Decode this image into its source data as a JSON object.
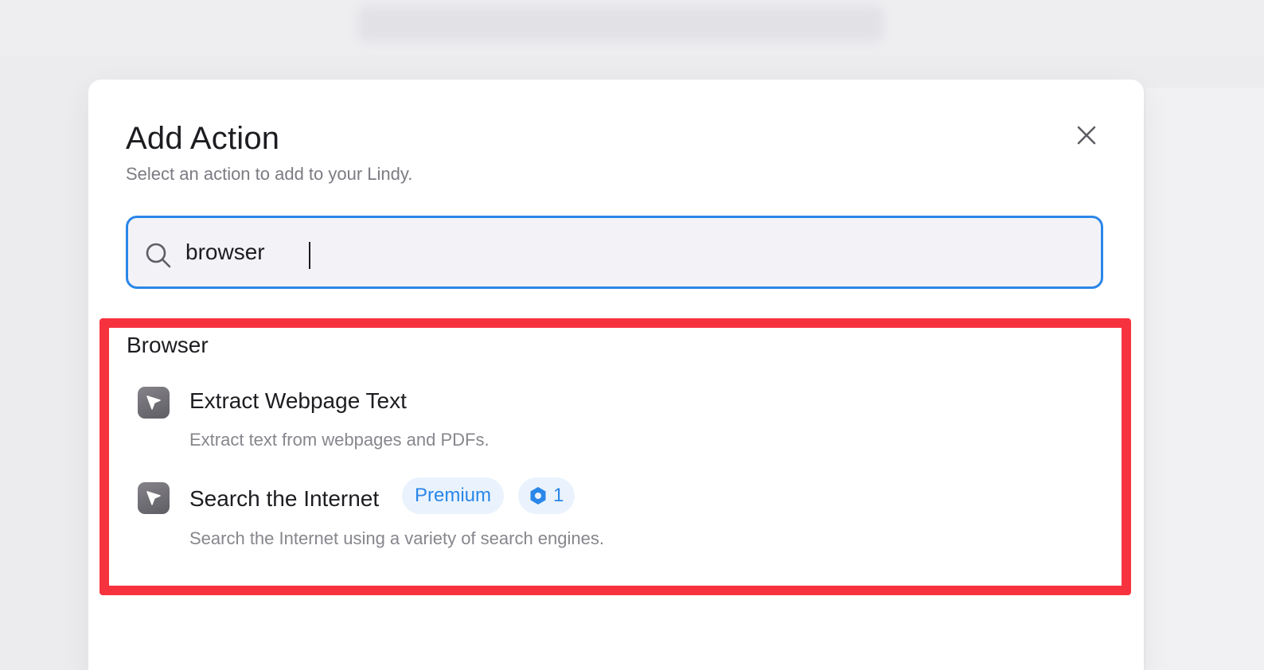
{
  "modal": {
    "title": "Add Action",
    "subtitle": "Select an action to add to your Lindy."
  },
  "search": {
    "value": "browser",
    "icon": "search-icon"
  },
  "results": {
    "group_label": "Browser",
    "items": [
      {
        "title": "Extract Webpage Text",
        "description": "Extract text from webpages and PDFs.",
        "icon": "cursor-arrow-icon"
      },
      {
        "title": "Search the Internet",
        "description": "Search the Internet using a variety of search engines.",
        "icon": "cursor-arrow-icon",
        "badge": "Premium",
        "credits": "1"
      }
    ]
  },
  "colors": {
    "accent": "#2a86e8",
    "highlight": "#f7323f"
  }
}
